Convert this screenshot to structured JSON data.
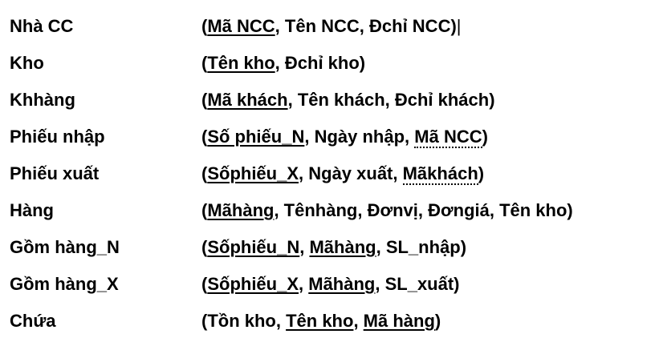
{
  "rows": [
    {
      "name": "Nhà CC",
      "tokens": [
        {
          "t": "("
        },
        {
          "t": "Mã NCC",
          "k": "pk"
        },
        {
          "t": ", Tên NCC, Đchỉ NCC)"
        },
        {
          "t": "|",
          "k": "cursor"
        }
      ]
    },
    {
      "name": "Kho",
      "tokens": [
        {
          "t": "("
        },
        {
          "t": "Tên kho",
          "k": "pk"
        },
        {
          "t": ", Đchỉ kho)"
        }
      ]
    },
    {
      "name": "Khhàng",
      "tokens": [
        {
          "t": "("
        },
        {
          "t": "Mã khách",
          "k": "pk"
        },
        {
          "t": ", Tên khách, Đchỉ khách)"
        }
      ]
    },
    {
      "name": "Phiếu nhập",
      "tokens": [
        {
          "t": "("
        },
        {
          "t": "Số phiếu_N",
          "k": "pk"
        },
        {
          "t": ", Ngày nhập, "
        },
        {
          "t": "Mã NCC",
          "k": "fk"
        },
        {
          "t": ")"
        }
      ]
    },
    {
      "name": "Phiếu xuất",
      "tokens": [
        {
          "t": "("
        },
        {
          "t": "Sốphiếu_X",
          "k": "pk"
        },
        {
          "t": ", Ngày xuất, "
        },
        {
          "t": "Mãkhách",
          "k": "fk"
        },
        {
          "t": ")"
        }
      ]
    },
    {
      "name": "Hàng",
      "tokens": [
        {
          "t": "("
        },
        {
          "t": "Mãhàng",
          "k": "pk"
        },
        {
          "t": ", Tênhàng, Đơnvị, Đơngiá, Tên kho)"
        }
      ]
    },
    {
      "name": "Gồm hàng_N",
      "tokens": [
        {
          "t": "("
        },
        {
          "t": "Sốphiếu_N",
          "k": "pk"
        },
        {
          "t": ", "
        },
        {
          "t": "Mãhàng",
          "k": "pk"
        },
        {
          "t": ", SL_nhập)"
        }
      ]
    },
    {
      "name": "Gồm hàng_X",
      "tokens": [
        {
          "t": "("
        },
        {
          "t": "Sốphiếu_X",
          "k": "pk"
        },
        {
          "t": ", "
        },
        {
          "t": "Mãhàng",
          "k": "pk"
        },
        {
          "t": ", SL_xuất)"
        }
      ]
    },
    {
      "name": "Chứa",
      "tokens": [
        {
          "t": "(Tồn kho, "
        },
        {
          "t": "Tên kho",
          "k": "pk"
        },
        {
          "t": ", "
        },
        {
          "t": "Mã hàng",
          "k": "pk"
        },
        {
          "t": ")"
        }
      ]
    }
  ]
}
